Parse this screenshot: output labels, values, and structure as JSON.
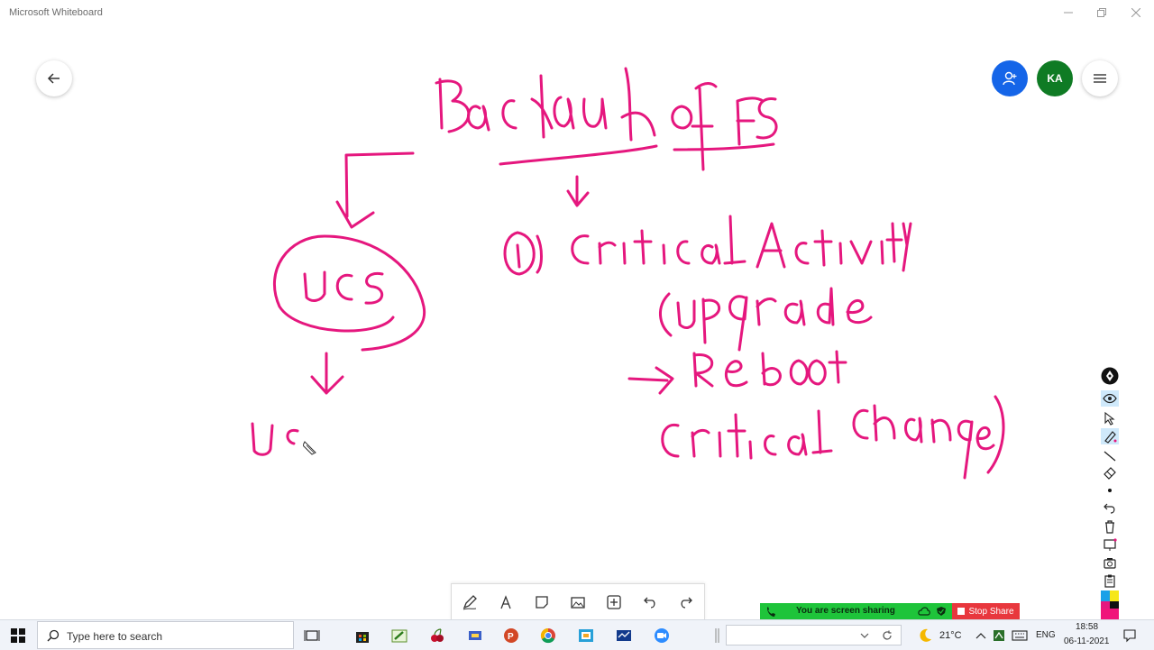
{
  "window": {
    "title": "Microsoft Whiteboard"
  },
  "header": {
    "avatar_initials": "KA"
  },
  "share_bar": {
    "status": "You are screen sharing",
    "stop_label": "Stop Share"
  },
  "taskbar": {
    "search_placeholder": "Type here to search",
    "weather": "21°C",
    "language": "ENG",
    "time": "18:58",
    "date": "06-11-2021"
  },
  "colors": {
    "ink": "#e5177e",
    "share_button": "#1565e8",
    "avatar": "#0f7b24",
    "share_green": "#1ec43a",
    "stop_red": "#e8373d"
  }
}
